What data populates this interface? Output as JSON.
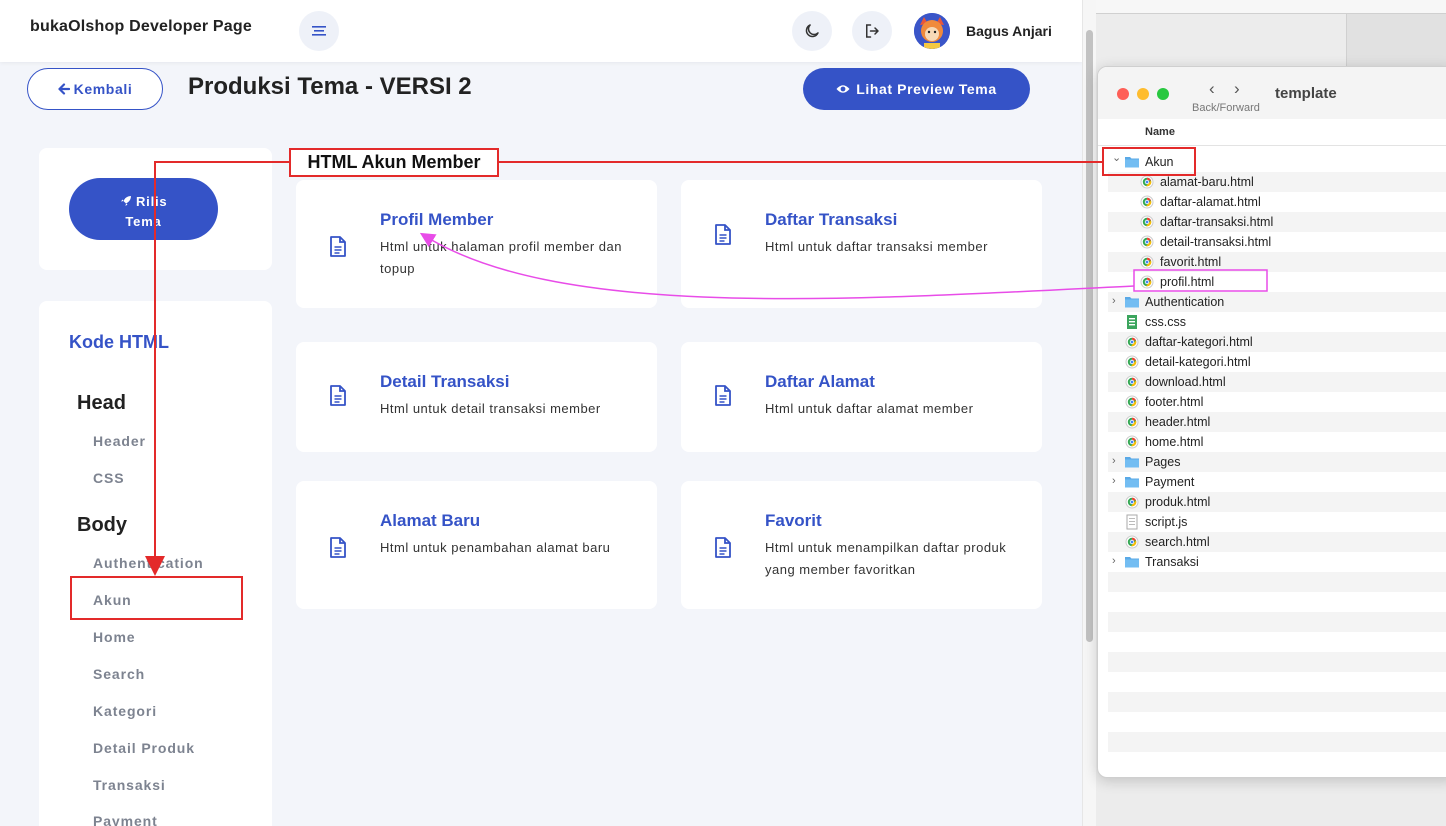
{
  "app": {
    "brand": "bukaOlshop Developer Page",
    "user_name": "Bagus Anjari",
    "back_label": "Kembali",
    "page_title": "Produksi Tema - VERSI 2",
    "preview_label": "Lihat Preview Tema",
    "rilis_label_line1": "Rilis",
    "rilis_label_line2": "Tema",
    "accent_color": "#3553c7"
  },
  "sidebar": {
    "title": "Kode HTML",
    "head_title": "Head",
    "head_items": [
      "Header",
      "CSS"
    ],
    "body_title": "Body",
    "body_items": [
      "Authentication",
      "Akun",
      "Home",
      "Search",
      "Kategori",
      "Detail Produk",
      "Transaksi",
      "Payment"
    ]
  },
  "cards": [
    {
      "title": "Profil Member",
      "desc": "Html untuk halaman profil member dan topup"
    },
    {
      "title": "Daftar Transaksi",
      "desc": "Html untuk daftar transaksi member"
    },
    {
      "title": "Detail Transaksi",
      "desc": "Html untuk detail transaksi member"
    },
    {
      "title": "Daftar Alamat",
      "desc": "Html untuk daftar alamat member"
    },
    {
      "title": "Alamat Baru",
      "desc": "Html untuk penambahan alamat baru"
    },
    {
      "title": "Favorit",
      "desc": "Html untuk menampilkan daftar produk yang member favoritkan"
    }
  ],
  "annotation": {
    "label": "HTML Akun Member",
    "red_color": "#e32a2a",
    "magenta_color": "#e84ce8"
  },
  "finder": {
    "title": "template",
    "nav_label": "Back/Forward",
    "column_name": "Name",
    "rows": [
      {
        "name": "Akun",
        "type": "folder",
        "expanded": true,
        "level": 0
      },
      {
        "name": "alamat-baru.html",
        "type": "html",
        "level": 1
      },
      {
        "name": "daftar-alamat.html",
        "type": "html",
        "level": 1
      },
      {
        "name": "daftar-transaksi.html",
        "type": "html",
        "level": 1
      },
      {
        "name": "detail-transaksi.html",
        "type": "html",
        "level": 1
      },
      {
        "name": "favorit.html",
        "type": "html",
        "level": 1
      },
      {
        "name": "profil.html",
        "type": "html",
        "level": 1
      },
      {
        "name": "Authentication",
        "type": "folder",
        "expanded": false,
        "level": 0
      },
      {
        "name": "css.css",
        "type": "css",
        "level": 0
      },
      {
        "name": "daftar-kategori.html",
        "type": "html",
        "level": 0
      },
      {
        "name": "detail-kategori.html",
        "type": "html",
        "level": 0
      },
      {
        "name": "download.html",
        "type": "html",
        "level": 0
      },
      {
        "name": "footer.html",
        "type": "html",
        "level": 0
      },
      {
        "name": "header.html",
        "type": "html",
        "level": 0
      },
      {
        "name": "home.html",
        "type": "html",
        "level": 0
      },
      {
        "name": "Pages",
        "type": "folder",
        "expanded": false,
        "level": 0
      },
      {
        "name": "Payment",
        "type": "folder",
        "expanded": false,
        "level": 0
      },
      {
        "name": "produk.html",
        "type": "html",
        "level": 0
      },
      {
        "name": "script.js",
        "type": "js",
        "level": 0
      },
      {
        "name": "search.html",
        "type": "html",
        "level": 0
      },
      {
        "name": "Transaksi",
        "type": "folder",
        "expanded": false,
        "level": 0
      }
    ]
  }
}
